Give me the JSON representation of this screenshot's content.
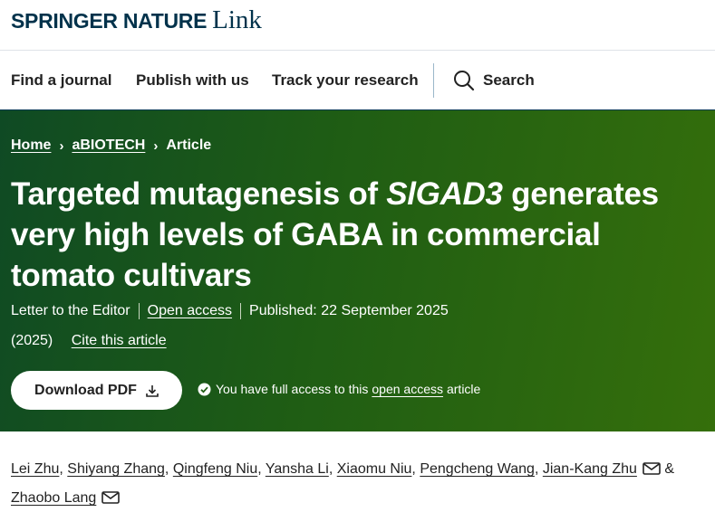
{
  "brand": {
    "name": "SPRINGER NATURE",
    "suffix": "Link"
  },
  "nav": {
    "find_journal": "Find a journal",
    "publish": "Publish with us",
    "track": "Track your research",
    "search": "Search"
  },
  "breadcrumb": {
    "home": "Home",
    "journal": "aBIOTECH",
    "current": "Article"
  },
  "article": {
    "title_before": "Targeted mutagenesis of ",
    "title_gene": "SlGAD3",
    "title_after": " generates very high levels of GABA in commercial tomato cultivars",
    "type": "Letter to the Editor",
    "open_access": "Open access",
    "published": "Published: 22 September 2025",
    "year": "(2025)",
    "cite": "Cite this article"
  },
  "download": {
    "label": "Download PDF"
  },
  "access": {
    "prefix": "You have full access to this",
    "link": "open access",
    "suffix": "article"
  },
  "authors": {
    "list": [
      "Lei Zhu",
      "Shiyang Zhang",
      "Qingfeng Niu",
      "Yansha Li",
      "Xiaomu Niu",
      "Pengcheng Wang",
      "Jian-Kang Zhu",
      "Zhaobo Lang"
    ],
    "sep": ",",
    "amp": "&"
  },
  "icons": [
    "search-icon",
    "download-icon",
    "check-circle-icon",
    "mail-icon"
  ],
  "colors": {
    "brand_navy": "#01324b",
    "hero_dark": "#0f4a24",
    "hero_light": "#356f0b"
  }
}
